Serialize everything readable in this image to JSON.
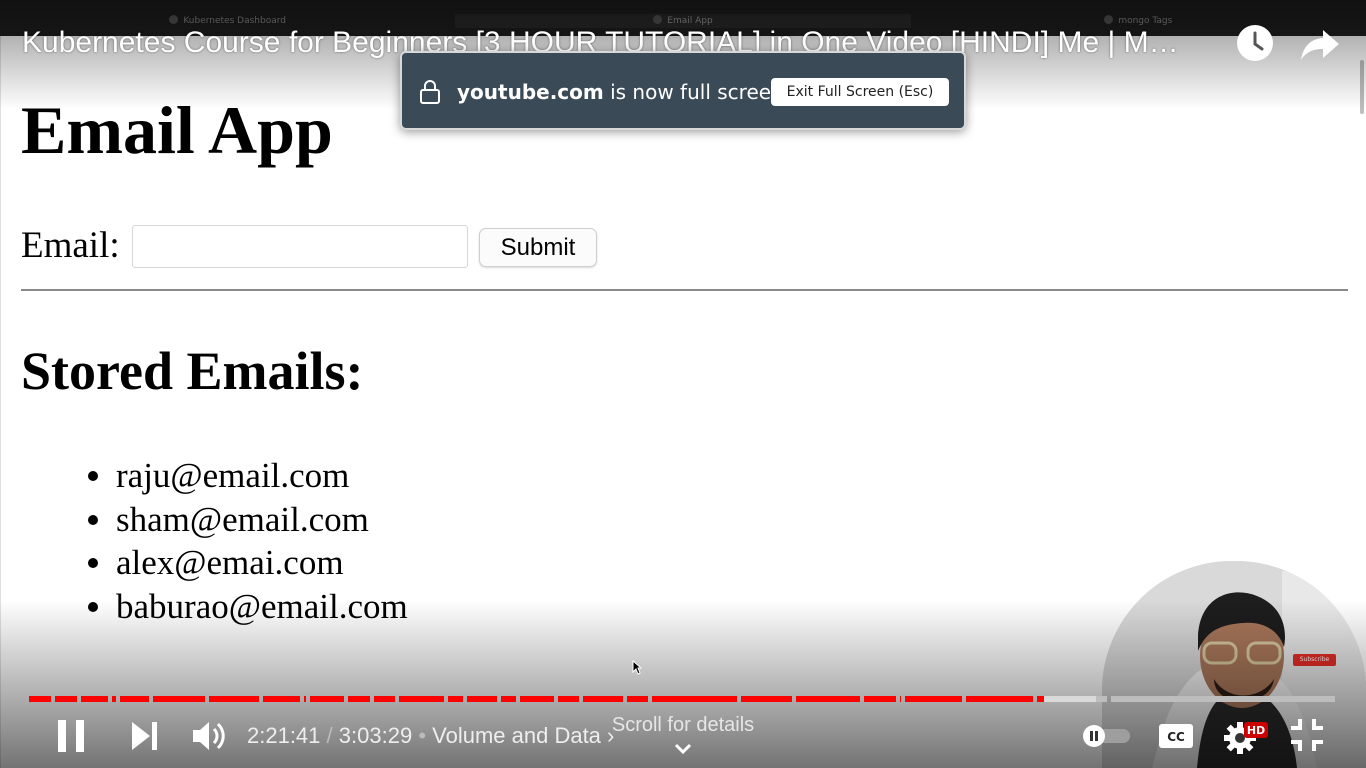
{
  "browser": {
    "tabs": [
      {
        "label": "Kubernetes Dashboard",
        "active": false
      },
      {
        "label": "Email App",
        "active": true
      },
      {
        "label": "mongo Tags",
        "active": false
      }
    ]
  },
  "page": {
    "title": "Email App",
    "form": {
      "email_label": "Email:",
      "email_value": "",
      "email_placeholder": "",
      "submit_label": "Submit"
    },
    "stored_heading": "Stored Emails:",
    "emails": [
      "raju@email.com",
      "sham@email.com",
      "alex@emai.com",
      "baburao@email.com"
    ]
  },
  "player": {
    "video_title": "Kubernetes Course for Beginners [3 HOUR TUTORIAL] in One Video [HINDI] Me | M…",
    "fullscreen_notice": {
      "domain": "youtube.com",
      "message": "is now full screen",
      "exit_label": "Exit Full Screen (Esc)"
    },
    "current_time": "2:21:41",
    "time_separator": "/",
    "duration": "3:03:29",
    "chapter_prefix": "•",
    "chapter": "Volume and Data",
    "chapter_arrow": "›",
    "scroll_hint": "Scroll for details",
    "progress_fraction": 0.776,
    "hd_badge": "HD",
    "subscribe_label": "Subscribe",
    "icons": {
      "watch_later": "clock-icon",
      "share": "share-arrow-icon",
      "play_pause": "pause-icon",
      "next": "next-icon",
      "volume": "volume-icon",
      "captions": "cc-icon",
      "settings": "gear-icon",
      "fullscreen": "exit-fullscreen-icon"
    },
    "colors": {
      "progress_played": "#ff0000",
      "progress_buffered": "#d9d9d9",
      "progress_remaining": "#bdbdbd",
      "hd_badge": "#cc0000",
      "notice_bg": "#3a4a57"
    }
  }
}
